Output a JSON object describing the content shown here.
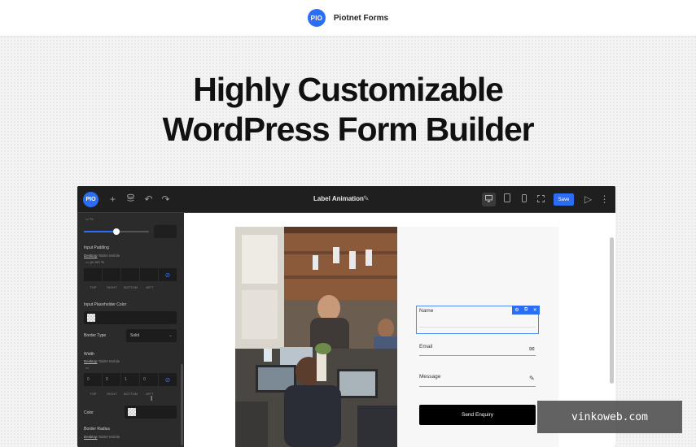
{
  "site": {
    "logo_text": "PIO",
    "brand_name": "Piotnet Forms"
  },
  "hero": {
    "line1": "Highly Customizable",
    "line2": "WordPress Form Builder"
  },
  "editor": {
    "logo_text": "PIO",
    "doc_title": "Label Animation",
    "save_label": "Save",
    "icons": [
      "plus-icon",
      "layers-icon",
      "undo-icon",
      "redo-icon",
      "desktop-icon",
      "tablet-icon",
      "mobile-icon",
      "fullscreen-icon",
      "play-icon",
      "more-icon"
    ]
  },
  "sidebar": {
    "unit_top": "%",
    "input_padding_label": "Input Padding",
    "responsive_desktop": "Desktop",
    "responsive_tablet": "Tablet",
    "responsive_mobile": "Mobile",
    "padding_units": "px   em   %",
    "sides": [
      "TOP",
      "RIGHT",
      "BOTTOM",
      "LEFT"
    ],
    "placeholder_color_label": "Input Placeholder Color",
    "border_type_label": "Border Type",
    "border_type_value": "Solid",
    "width_label": "Width",
    "width_unit": "px",
    "width_values": [
      "0",
      "0",
      "1",
      "0"
    ],
    "color_label": "Color",
    "border_radius_label": "Border Radius"
  },
  "form": {
    "name_label": "Name",
    "email_label": "Email",
    "message_label": "Message",
    "submit_label": "Send Enquiry"
  },
  "watermark": "vinkoweb.com"
}
